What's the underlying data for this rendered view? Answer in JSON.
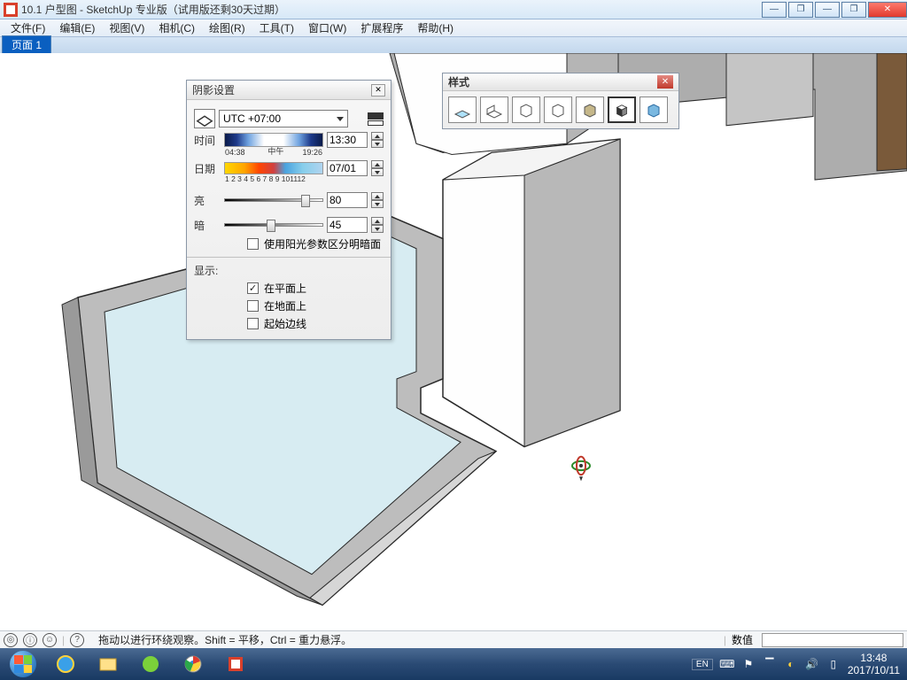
{
  "title": "10.1 户型图 - SketchUp 专业版（试用版还剩30天过期）",
  "menu": [
    "文件(F)",
    "编辑(E)",
    "视图(V)",
    "相机(C)",
    "绘图(R)",
    "工具(T)",
    "窗口(W)",
    "扩展程序",
    "帮助(H)"
  ],
  "scenetab": "页面 1",
  "shadow_panel": {
    "title": "阴影设置",
    "timezone": "UTC +07:00",
    "time_label": "时间",
    "time_ticks": {
      "left": "04:38",
      "mid": "中午",
      "right": "19:26"
    },
    "time_value": "13:30",
    "date_label": "日期",
    "date_months": "1 2 3 4 5 6 7 8 9 101112",
    "date_value": "07/01",
    "bright_label": "亮",
    "bright_value": "80",
    "dark_label": "暗",
    "dark_value": "45",
    "use_sun": "使用阳光参数区分明暗面",
    "display_label": "显示:",
    "on_faces": "在平面上",
    "on_ground": "在地面上",
    "from_edges": "起始边线"
  },
  "styles_panel": {
    "title": "样式"
  },
  "status": {
    "hint": "拖动以进行环绕观察。Shift = 平移，Ctrl = 重力悬浮。",
    "vcb_label": "数值"
  },
  "tray": {
    "lang": "EN",
    "time": "13:48",
    "date": "2017/10/11"
  }
}
